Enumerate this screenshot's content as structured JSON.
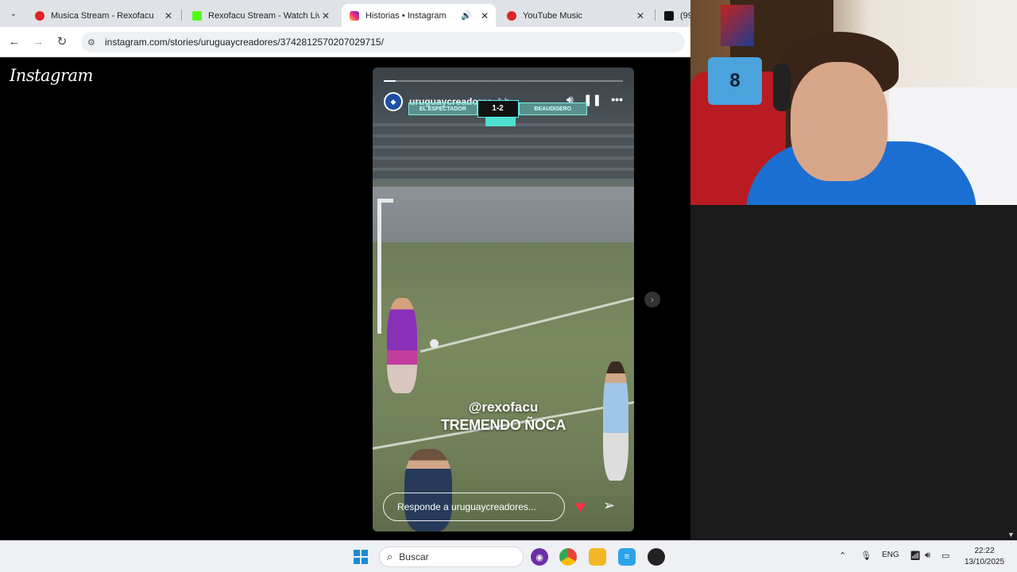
{
  "browser": {
    "tabs": [
      {
        "title": "Musica Stream - Rexofacu",
        "icon": "youtube-icon",
        "color": "#e02424",
        "active": false
      },
      {
        "title": "Rexofacu Stream - Watch Live o",
        "icon": "kick-icon",
        "color": "#53fc18",
        "active": false
      },
      {
        "title": "Historias • Instagram",
        "icon": "instagram-icon",
        "color": "#d6249f",
        "active": true
      },
      {
        "title": "YouTube Music",
        "icon": "youtube-music-icon",
        "color": "#e02424",
        "active": false
      },
      {
        "title": "(99",
        "icon": "tiktok-icon",
        "color": "#111111",
        "active": false
      }
    ],
    "url": "instagram.com/stories/uruguaycreadores/3742812570207029715/"
  },
  "instagram": {
    "logo": "Instagram",
    "story": {
      "username": "uruguaycreadores",
      "time": "1 h",
      "progress_fraction": 0.05,
      "scorebug": {
        "home": "EL ESPECTADOR",
        "score": "1-2",
        "away": "BEAUDISERO"
      },
      "overlay_line1": "@rexofacu",
      "overlay_line2": "TREMENDO ÑOCA",
      "reply_placeholder": "Responde a uruguaycreadores..."
    }
  },
  "taskbar": {
    "search_placeholder": "Buscar",
    "language": "ENG",
    "time": "22:22",
    "date": "13/10/2025"
  },
  "webcam": {
    "jersey_number": "8"
  }
}
